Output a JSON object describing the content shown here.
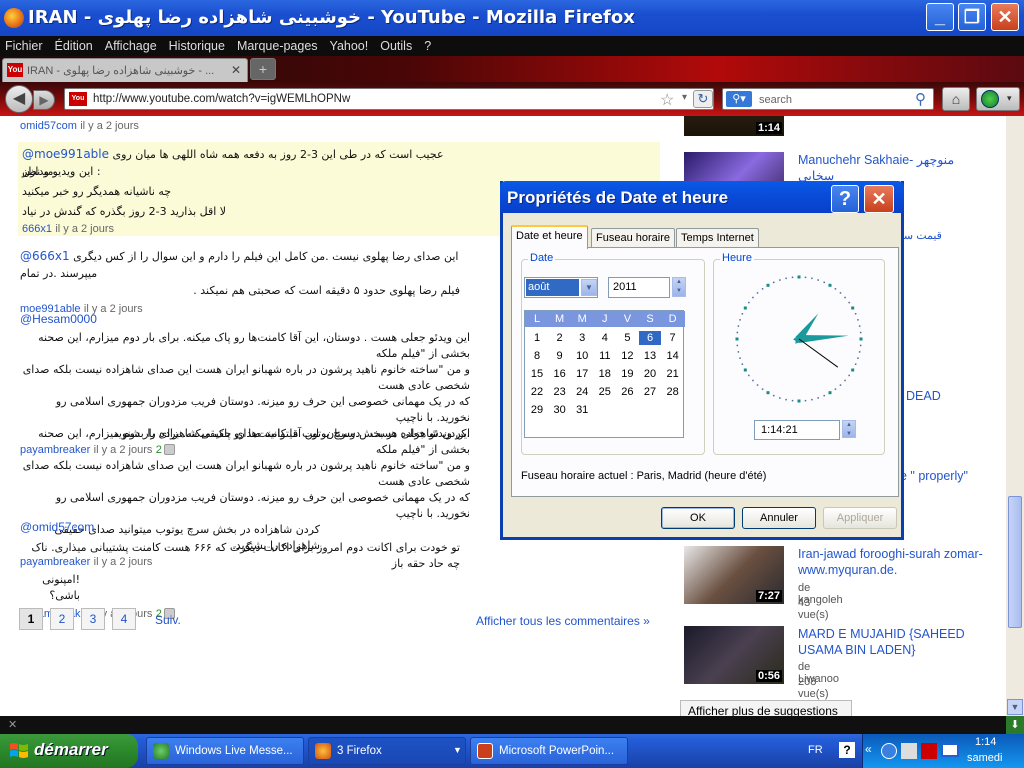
{
  "window": {
    "title": "IRAN - خوشبینی شاهزاده رضا پهلوی - YouTube - Mozilla Firefox"
  },
  "menu": [
    "Fichier",
    "Édition",
    "Affichage",
    "Historique",
    "Marque-pages",
    "Yahoo!",
    "Outils",
    "?"
  ],
  "tab": {
    "title": "IRAN - خوشبینی شاهزاده رضا پهلوی - ...",
    "yt": "You"
  },
  "nav": {
    "url": "http://www.youtube.com/watch?v=igWEMLhOPNw",
    "search_placeholder": "search"
  },
  "comments": [
    {
      "author": "omid57com",
      "time": "il y a 2 jours"
    },
    {
      "mention": "@moe991able",
      "line1": "عجیب است که در طی این 3-2 روز به دفعه همه شاه اللهی ها میان روی این ویدیو و نظر :",
      "line1b": "میدارن",
      "line2": "چه ناشیانه همدیگر رو خبر میکنید",
      "line3": "لا اقل بذارید 3-2 روز بگذره که گندش در نیاد",
      "author": "666x1",
      "time": "il y a 2 jours"
    },
    {
      "mention": "@666x1",
      "line1": "این صدای رضا پهلوی نیست .من کامل این فیلم را دارم و این سوال را از کس دیگری میپرسند .در تمام",
      "line2": "فیلم رضا پهلوی حدود ۵ دقیقه است که صحبتی هم نمیکند .",
      "author": "moe991able",
      "time": "il y a 2 jours"
    },
    {
      "mention": "@Hesam0000",
      "line1": "این ویدئو جعلی هست . دوستان، این آقا کامنت‌ها رو پاک میکنه. برای بار دوم میزارم، این صحنه بخشی از \"فیلم ملکه",
      "line2": "و من \"ساخته خانوم ناهید پرشون در باره شهبانو ایران هست این صدای شاهزاده نیست بلکه صدای شخصی عادی هست",
      "line3": "که در یک مهمانی خصوصی این حرف رو میزنه. دوستان فریب مزدوران جمهوری اسلامی رو نخورید. با ناچیپ",
      "line4": ".کردن شاهزاده در بخش سرچ یوتوب میتوانید صدای حقیقی شاهزاده را بشنوید",
      "author": "payambreaker",
      "time": "il y a 2 jours",
      "likes": "2"
    },
    {
      "line1": "این ویدئو جعلی هست . دوستان، این آقا کامنت‌ها رو پاک میکنه. برای بار دوم میزارم، این صحنه بخشی از \"فیلم ملکه",
      "line2": "و من \"ساخته خانوم ناهید پرشون در باره شهبانو ایران هست این صدای شاهزاده نیست بلکه صدای شخصی عادی هست",
      "line3": "که در یک مهمانی خصوصی این حرف رو میزنه. دوستان فریب مزدوران جمهوری اسلامی رو نخورید. با ناچیپ",
      "line4": "کردن شاهزاده در بخش سرچ یوتوب میتوانید صدای حقیقی شاهزاده را بشنوید.",
      "author": "payambreaker",
      "time": "il y a 2 jours"
    },
    {
      "mention": "@omid57com",
      "line1": "تو خودت برای اکانت دوم امروز برای اکانت دیگرت که ۶۶۶ هست کامنت پشتیبانی میذاری. ناک چه حاد حقه باز",
      "line2": "!امپنونی باشی؟",
      "author": "payambreaker",
      "time": "il y a 2 jours",
      "likes": "2"
    }
  ],
  "pagination": {
    "pages": [
      "1",
      "2",
      "3",
      "4"
    ],
    "next": "Suiv.",
    "all": "Afficher tous les commentaires »"
  },
  "sidebar": [
    {
      "dur": "1:14"
    },
    {
      "title": "Manuchehr Sakhaie- منوچهر سخایی"
    },
    {
      "title": "قیمت سکه د"
    },
    {
      "title": "DEAD"
    },
    {
      "title": "e \" properly\""
    },
    {
      "title": "Iran-jawad forooghi-surah zomar-www.myquran.de.",
      "by": "de kangoleh",
      "views": "43 vue(s)",
      "dur": "7:27"
    },
    {
      "title": "MARD E MUJAHID {SAHEED USAMA BIN LADEN}",
      "by": "de Liwanoo",
      "views": "208 vue(s)",
      "dur": "0:56"
    }
  ],
  "more_suggestions": "Afficher plus de suggestions",
  "dialog": {
    "title": "Propriétés de Date et heure",
    "tabs": [
      "Date et heure",
      "Fuseau horaire",
      "Temps Internet"
    ],
    "date_label": "Date",
    "time_label": "Heure",
    "month": "août",
    "year": "2011",
    "weekdays": [
      "L",
      "M",
      "M",
      "J",
      "V",
      "S",
      "D"
    ],
    "days": [
      "1",
      "2",
      "3",
      "4",
      "5",
      "6",
      "7",
      "8",
      "9",
      "10",
      "11",
      "12",
      "13",
      "14",
      "15",
      "16",
      "17",
      "18",
      "19",
      "20",
      "21",
      "22",
      "23",
      "24",
      "25",
      "26",
      "27",
      "28",
      "29",
      "30",
      "31"
    ],
    "selected_day": "6",
    "time": "1:14:21",
    "timezone": "Fuseau horaire actuel : Paris, Madrid (heure d'été)",
    "ok": "OK",
    "cancel": "Annuler",
    "apply": "Appliquer"
  },
  "taskbar": {
    "start": "démarrer",
    "buttons": [
      "Windows Live Messe...",
      "3 Firefox",
      "Microsoft PowerPoin..."
    ],
    "lang": "FR",
    "clock": "1:14",
    "day": "samedi"
  },
  "colors": {
    "link": "#2255cc",
    "titlebar": "#1a4fcf",
    "start": "#2e8c2e"
  }
}
